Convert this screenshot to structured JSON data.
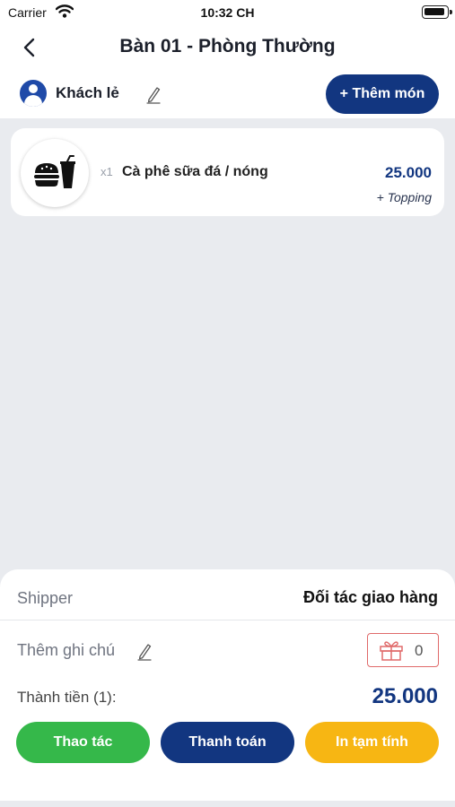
{
  "status_bar": {
    "carrier": "Carrier",
    "time": "10:32 CH"
  },
  "header": {
    "title": "Bàn 01 - Phòng Thường",
    "customer_name": "Khách lẻ",
    "add_item_label": "+ Thêm món"
  },
  "order_items": [
    {
      "quantity": "x1",
      "name": "Cà phê sữa đá / nóng",
      "price": "25.000",
      "topping_label": "+ Topping",
      "icon": "burger-drink-icon"
    }
  ],
  "summary": {
    "shipper_label": "Shipper",
    "shipper_value": "Đối tác giao hàng",
    "note_label": "Thêm ghi chú",
    "gift_count": "0",
    "total_label": "Thành tiền (1):",
    "total_value": "25.000"
  },
  "actions": {
    "operations_label": "Thao tác",
    "payment_label": "Thanh toán",
    "print_label": "In tạm tính"
  },
  "colors": {
    "primary": "#123680",
    "green": "#35b84a",
    "yellow": "#f7b613",
    "gift_border": "#e06a6a",
    "background": "#e9ebef"
  }
}
